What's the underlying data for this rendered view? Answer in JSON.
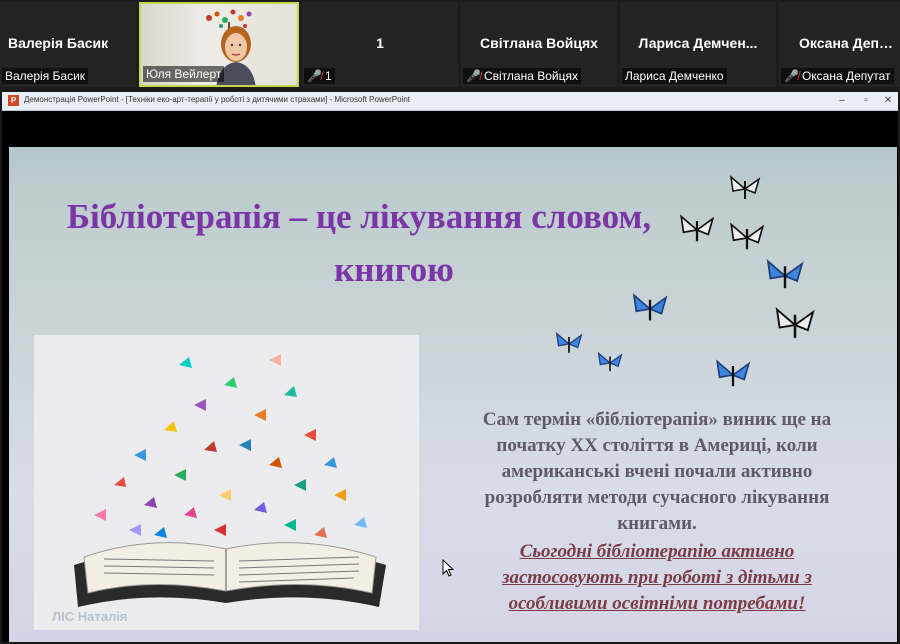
{
  "participants": [
    {
      "display": "Валерія Басик",
      "caption": "Валерія Басик",
      "muted": false,
      "video": false
    },
    {
      "display": "",
      "caption": "Юля Вейлерт",
      "muted": false,
      "video": true
    },
    {
      "display": "1",
      "caption": "1",
      "muted": true,
      "video": false
    },
    {
      "display": "Світлана Войцях",
      "caption": "Світлана Войцях",
      "muted": true,
      "video": false
    },
    {
      "display": "Лариса  Демчен...",
      "caption": "Лариса Демченко",
      "muted": false,
      "video": false
    },
    {
      "display": "Оксана Депутат",
      "caption": "Оксана Депутат",
      "muted": true,
      "video": false
    }
  ],
  "window": {
    "title": "Демонстрація PowerPoint - [Техніки еко-арт-терапії у роботі з дитячими страхами] - Microsoft PowerPoint",
    "app_icon": "powerpoint-icon",
    "app_icon_letter": "P",
    "controls": {
      "minimize": "–",
      "maximize": "▫",
      "close": "✕"
    }
  },
  "slide": {
    "title_line1": "Бібліотерапія – це лікування словом,",
    "title_line2": "книгою",
    "title_color": "#7c35a6",
    "image_watermark": "ЛІС Наталія",
    "body_lines": [
      "Сам термін «бібліотерапія» виник ще на",
      "початку XX століття в Америці,  коли",
      "американські  вчені почали  активно",
      "розробляти методи сучасного  лікування",
      "книгами."
    ],
    "emphasis_lines": [
      "Сьогодні бібліотерапію активно",
      "застосовують при роботі з дітьми з",
      "особливими освітніми потребами!"
    ]
  }
}
